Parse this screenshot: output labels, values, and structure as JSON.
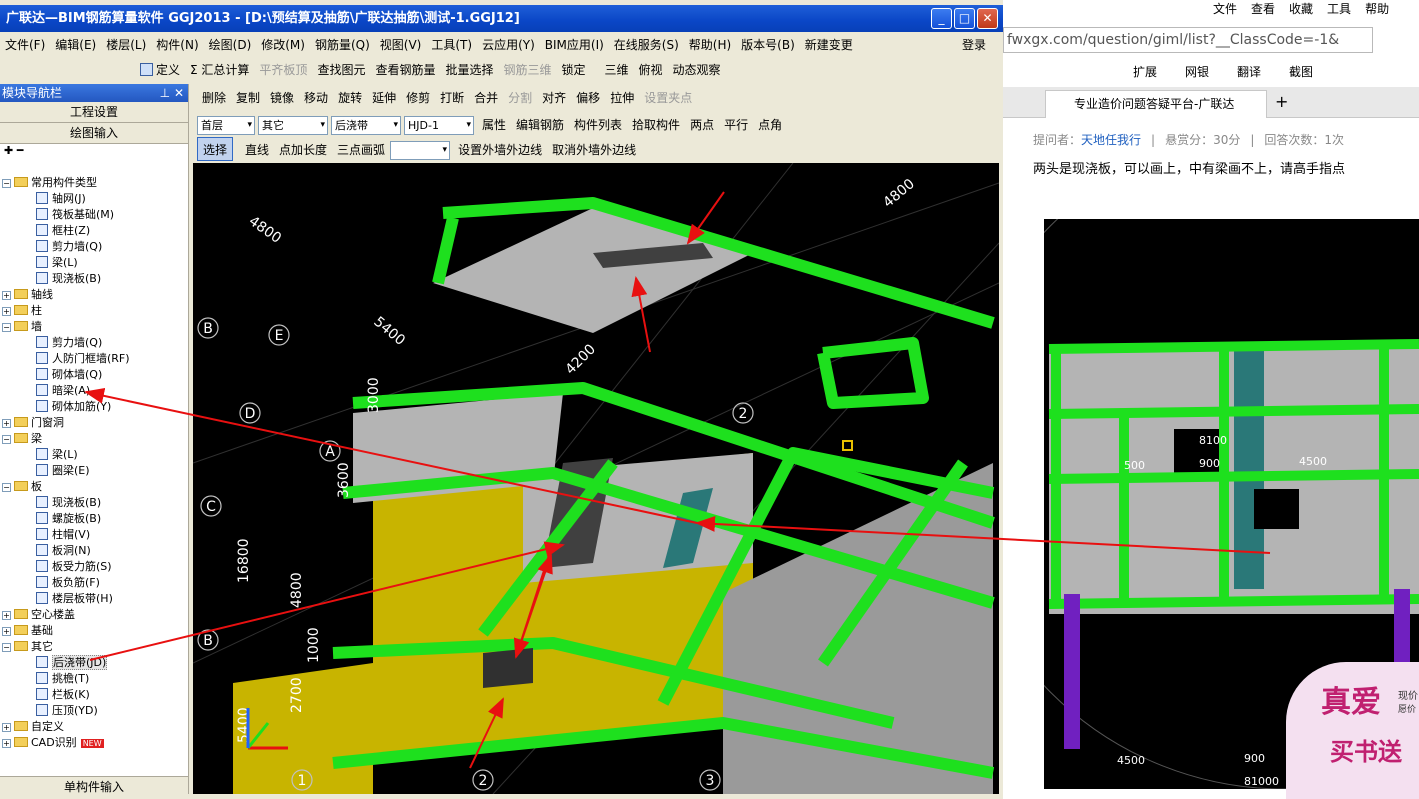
{
  "app": {
    "title": "广联达—BIM钢筋算量软件 GGJ2013 - [D:\\预结算及抽筋\\广联达抽筋\\测试-1.GGJ12]",
    "window_buttons": [
      "_",
      "□",
      "✕"
    ],
    "menu": [
      "文件(F)",
      "编辑(E)",
      "楼层(L)",
      "构件(N)",
      "绘图(D)",
      "修改(M)",
      "钢筋量(Q)",
      "视图(V)",
      "工具(T)",
      "云应用(Y)",
      "BIM应用(I)",
      "在线服务(S)",
      "帮助(H)",
      "版本号(B)",
      "新建变更"
    ],
    "login": "登录",
    "toolbar1": [
      "定义",
      "Σ 汇总计算",
      "平齐板顶",
      "查找图元",
      "查看钢筋量",
      "批量选择",
      "钢筋三维",
      "锁定"
    ],
    "toolbar1_right": [
      "三维",
      "俯视",
      "动态观察"
    ],
    "toolbar2": [
      "删除",
      "复制",
      "镜像",
      "移动",
      "旋转",
      "延伸",
      "修剪",
      "打断",
      "合并",
      "分割",
      "对齐",
      "偏移",
      "拉伸",
      "设置夹点"
    ],
    "toolbar3": {
      "floor": "首层",
      "type": "其它",
      "component": "后浇带",
      "name": "HJD-1",
      "buttons": [
        "属性",
        "编辑钢筋",
        "构件列表",
        "拾取构件",
        "两点",
        "平行",
        "点角"
      ]
    },
    "toolbar4": [
      "选择",
      "直线",
      "点加长度",
      "三点画弧",
      "设置外墙外边线",
      "取消外墙外边线"
    ]
  },
  "nav": {
    "title": "模块导航栏",
    "pin": "⊥ ✕",
    "buttons": [
      "工程设置",
      "绘图输入"
    ],
    "bottom": "单构件输入",
    "tree": [
      {
        "label": "常用构件类型",
        "level": 0,
        "folder": true,
        "open": true
      },
      {
        "label": "轴网(J)",
        "level": 1
      },
      {
        "label": "筏板基础(M)",
        "level": 1
      },
      {
        "label": "框柱(Z)",
        "level": 1
      },
      {
        "label": "剪力墙(Q)",
        "level": 1
      },
      {
        "label": "梁(L)",
        "level": 1
      },
      {
        "label": "现浇板(B)",
        "level": 1
      },
      {
        "label": "轴线",
        "level": 0,
        "folder": true
      },
      {
        "label": "柱",
        "level": 0,
        "folder": true
      },
      {
        "label": "墙",
        "level": 0,
        "folder": true,
        "open": true
      },
      {
        "label": "剪力墙(Q)",
        "level": 1
      },
      {
        "label": "人防门框墙(RF)",
        "level": 1
      },
      {
        "label": "砌体墙(Q)",
        "level": 1
      },
      {
        "label": "暗梁(A)",
        "level": 1
      },
      {
        "label": "砌体加筋(Y)",
        "level": 1
      },
      {
        "label": "门窗洞",
        "level": 0,
        "folder": true
      },
      {
        "label": "梁",
        "level": 0,
        "folder": true,
        "open": true
      },
      {
        "label": "梁(L)",
        "level": 1
      },
      {
        "label": "圈梁(E)",
        "level": 1
      },
      {
        "label": "板",
        "level": 0,
        "folder": true,
        "open": true
      },
      {
        "label": "现浇板(B)",
        "level": 1
      },
      {
        "label": "螺旋板(B)",
        "level": 1
      },
      {
        "label": "柱帽(V)",
        "level": 1
      },
      {
        "label": "板洞(N)",
        "level": 1
      },
      {
        "label": "板受力筋(S)",
        "level": 1
      },
      {
        "label": "板负筋(F)",
        "level": 1
      },
      {
        "label": "楼层板带(H)",
        "level": 1
      },
      {
        "label": "空心楼盖",
        "level": 0,
        "folder": true
      },
      {
        "label": "基础",
        "level": 0,
        "folder": true
      },
      {
        "label": "其它",
        "level": 0,
        "folder": true,
        "open": true
      },
      {
        "label": "后浇带(JD)",
        "level": 1,
        "selected": true
      },
      {
        "label": "挑檐(T)",
        "level": 1
      },
      {
        "label": "栏板(K)",
        "level": 1
      },
      {
        "label": "压顶(YD)",
        "level": 1
      },
      {
        "label": "自定义",
        "level": 0,
        "folder": true
      },
      {
        "label": "CAD识别",
        "level": 0,
        "folder": true,
        "badge": "NEW"
      }
    ]
  },
  "view": {
    "dims": [
      "4800",
      "4800",
      "5400",
      "4200",
      "3000",
      "3600",
      "16800",
      "4800",
      "1000",
      "2700",
      "5400"
    ],
    "axes": [
      "B",
      "E",
      "D",
      "A",
      "C",
      "B",
      "2",
      "1",
      "2",
      "3"
    ]
  },
  "browser": {
    "menu": [
      "文件",
      "查看",
      "收藏",
      "工具",
      "帮助"
    ],
    "url": "fwxgx.com/question/giml/list?__ClassCode=-1&",
    "bookmarks": [
      "扩展",
      "网银",
      "翻译",
      "截图"
    ],
    "tab": "专业造价问题答疑平台-广联达",
    "meta": {
      "asker_label": "提问者：",
      "asker": "天地任我行",
      "reward": "悬赏分：30分",
      "answers": "回答次数：1次"
    },
    "question": "两头是现浇板，可以画上，中有梁画不上，请高手指点",
    "image_dims": [
      "8100",
      "500",
      "900",
      "4500",
      "4500",
      "900",
      "81000"
    ],
    "ad": [
      "真爱",
      "买书送",
      "现价",
      "愿价"
    ]
  },
  "colors": {
    "green": "#1ee01e",
    "gray": "#b4b4b4",
    "yellow": "#c8b400",
    "red": "#e81010",
    "teal": "#2a7878",
    "purple": "#7020c0"
  }
}
